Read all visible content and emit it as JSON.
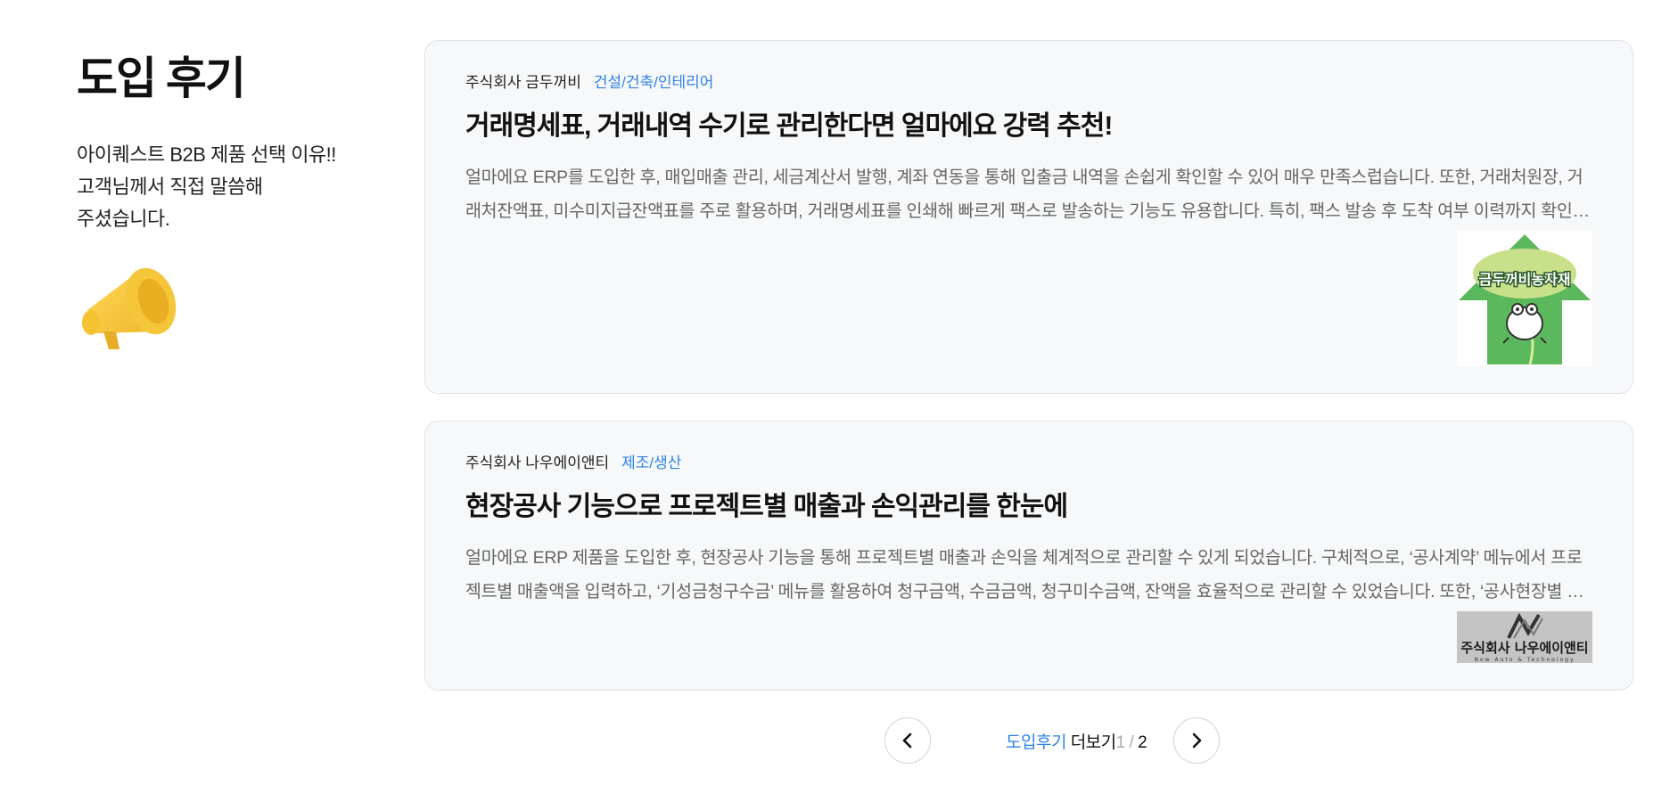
{
  "section": {
    "title": "도입 후기",
    "subtitle_lines": [
      "아이퀘스트 B2B 제품 선택 이유!!",
      "고객님께서 직접 말씀해",
      "주셨습니다."
    ]
  },
  "reviews": [
    {
      "company": "주식회사 금두꺼비",
      "category": "건설/건축/인테리어",
      "title": "거래명세표, 거래내역 수기로 관리한다면 얼마에요 강력 추천!",
      "excerpt": "얼마에요 ERP를 도입한 후, 매입매출 관리, 세금계산서 발행, 계좌 연동을 통해  입출금 내역을 손쉽게 확인할 수 있어 매우 만족스럽습니다.  또한, 거래처원장, 거래처잔액표, 미수미지급잔액표를 주로 활용하며,  거래명세표를 인쇄해 빠르게 팩스로 발송하는 기능도 유용합니다.  특히, 팩스 발송 후 도착 여부 이력까지 확인할 수 있어 편리합니다.",
      "logo_text": "금두꺼비농자재"
    },
    {
      "company": "주식회사 나우에이앤티",
      "category": "제조/생산",
      "title": "현장공사 기능으로 프로젝트별 매출과 손익관리를 한눈에",
      "excerpt": "얼마에요 ERP 제품을 도입한 후, 현장공사 기능을 통해 프로젝트별 매출과 손익을 체계적으로 관리할 수 있게 되었습니다.    구체적으로, ‘공사계약’ 메뉴에서 프로젝트별 매출액을 입력하고,  ‘기성금청구수금’ 메뉴를 활용하여 청구금액, 수금금액, 청구미수금액, 잔액을 효율적으로 관리할 수 있었습니다.  또한, ‘공사현장별 손익’ 메뉴로 확인합니다.",
      "logo_text": "주식회사 나우에이앤티",
      "logo_sub": "Now Auto & Technology"
    }
  ],
  "pagination": {
    "label_highlight": "도입후기",
    "label_more": "더보기",
    "current": "1",
    "separator": "/",
    "total": "2"
  },
  "colors": {
    "accent": "#2d82e8",
    "card_bg": "#f7f8f9",
    "frog_green": "#5cb85c"
  },
  "icons": {
    "megaphone": "megaphone-icon",
    "prev": "chevron-left-icon",
    "next": "chevron-right-icon"
  }
}
